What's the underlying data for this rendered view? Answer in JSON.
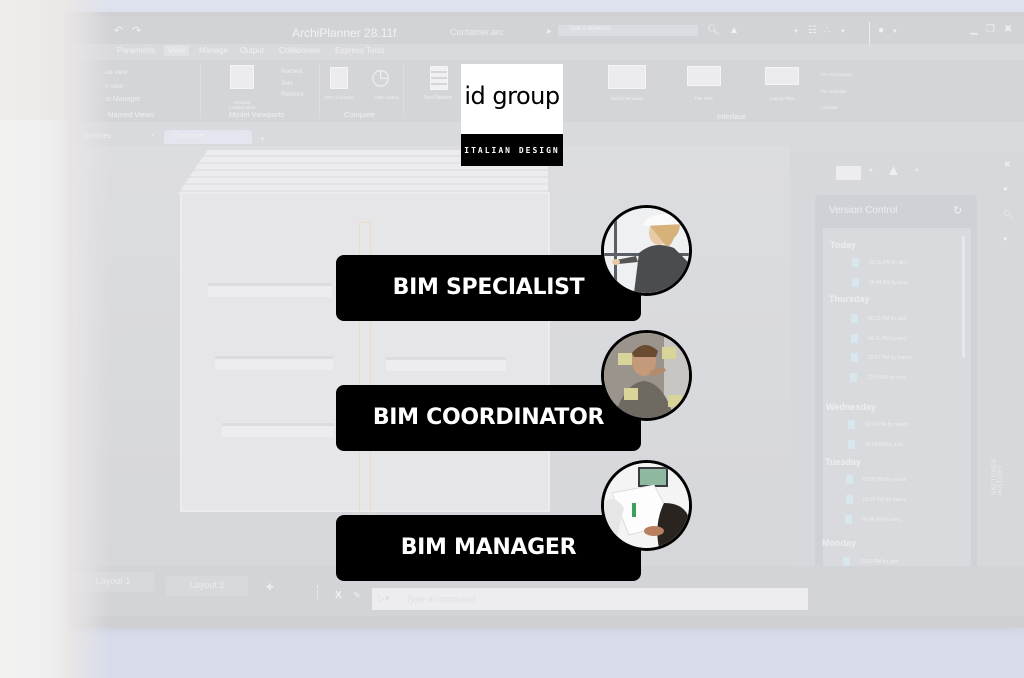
{
  "app": {
    "title": "ArchiPlanner 28.11f",
    "file_name": "Container.arc",
    "search_placeholder": "Type a keyword"
  },
  "ribbon": {
    "tabs": [
      "Parametric",
      "View",
      "Manage",
      "Output",
      "Collaborate",
      "Express Tools"
    ],
    "active_tab": "View",
    "groups": {
      "named_views": {
        "label": "Named Views",
        "items": [
          "...ed view",
          "...v view",
          "...w Manager"
        ]
      },
      "model_viewports": {
        "label": "Model Viewports",
        "viewport_config": "Viewport Configuration",
        "items": [
          "Named",
          "Join",
          "Restore"
        ]
      },
      "compare": {
        "label": "Compare",
        "items": [
          "ARC Compare",
          "ARC History"
        ]
      },
      "tool_palettes": "Tool Palettes",
      "interface": {
        "label": "Interface",
        "items": [
          "Switch Windows",
          "File Tabs",
          "Layout Tabs"
        ],
        "small_items": [
          "Tile Horizontally",
          "Tile Vertically",
          "Cascade"
        ]
      }
    }
  },
  "doc_tabs": [
    {
      "label": "Sketches",
      "active": false
    },
    {
      "label": "Container",
      "active": true
    }
  ],
  "version_control": {
    "title": "Version Control",
    "side_label": "SKETCHES HISTORY",
    "days": [
      {
        "day": "Today",
        "entries": [
          "03:15 PM by larry",
          "09:44 AM by larry"
        ]
      },
      {
        "day": "Thursday",
        "entries": [
          "06:23 PM by josh",
          "04:11 PM by larry",
          "12:57 PM by marco",
          "10:03 AM by larry"
        ]
      },
      {
        "day": "Wednesday",
        "entries": [
          "02:41 PM by marco",
          "11:18 AM by josh"
        ]
      },
      {
        "day": "Tuesday",
        "entries": [
          "05:02 PM by marco",
          "03:27 PM by marco",
          "08:44 AM by larry"
        ]
      },
      {
        "day": "Monday",
        "entries": [
          "01:00 PM by josh"
        ]
      }
    ]
  },
  "layout_tabs": [
    "Layout 1",
    "Layout 2"
  ],
  "command_line": {
    "placeholder": "Type a command"
  },
  "logo": {
    "wordmark": "id group",
    "tagline": "ITALIAN DESIGN"
  },
  "roles": [
    {
      "label": "BIM SPECIALIST",
      "avatar": "woman-in-hard-hat-pointing"
    },
    {
      "label": "BIM COORDINATOR",
      "avatar": "man-writing-on-glass-with-sticky-notes"
    },
    {
      "label": "BIM MANAGER",
      "avatar": "team-reviewing-documents-and-laptop"
    }
  ]
}
